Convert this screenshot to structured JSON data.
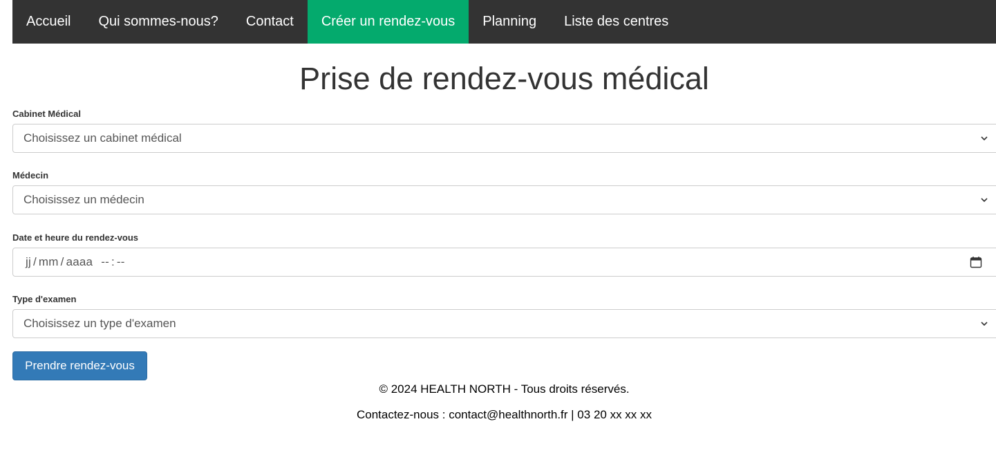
{
  "nav": {
    "items": [
      {
        "label": "Accueil",
        "active": false
      },
      {
        "label": "Qui sommes-nous?",
        "active": false
      },
      {
        "label": "Contact",
        "active": false
      },
      {
        "label": "Créer un rendez-vous",
        "active": true
      },
      {
        "label": "Planning",
        "active": false
      },
      {
        "label": "Liste des centres",
        "active": false
      }
    ],
    "bg_color": "#333333",
    "active_color": "#04aa6d"
  },
  "page": {
    "title": "Prise de rendez-vous médical"
  },
  "form": {
    "cabinet": {
      "label": "Cabinet Médical",
      "value": "Choisissez un cabinet médical"
    },
    "medecin": {
      "label": "Médecin",
      "value": "Choisissez un médecin"
    },
    "datetime": {
      "label": "Date et heure du rendez-vous",
      "day": "jj",
      "month": "mm",
      "year": "aaaa",
      "hour": "--",
      "minute": "--",
      "date_sep": "/",
      "time_sep": ":"
    },
    "exam": {
      "label": "Type d'examen",
      "value": "Choisissez un type d'examen"
    },
    "submit_label": "Prendre rendez-vous",
    "submit_color": "#337ab7"
  },
  "footer": {
    "copyright": "© 2024 HEALTH NORTH - Tous droits réservés.",
    "contact": "Contactez-nous : contact@healthnorth.fr | 03 20 xx xx xx"
  },
  "icons": {
    "select_arrow": "chevron-down-icon",
    "date_picker": "calendar-icon"
  }
}
